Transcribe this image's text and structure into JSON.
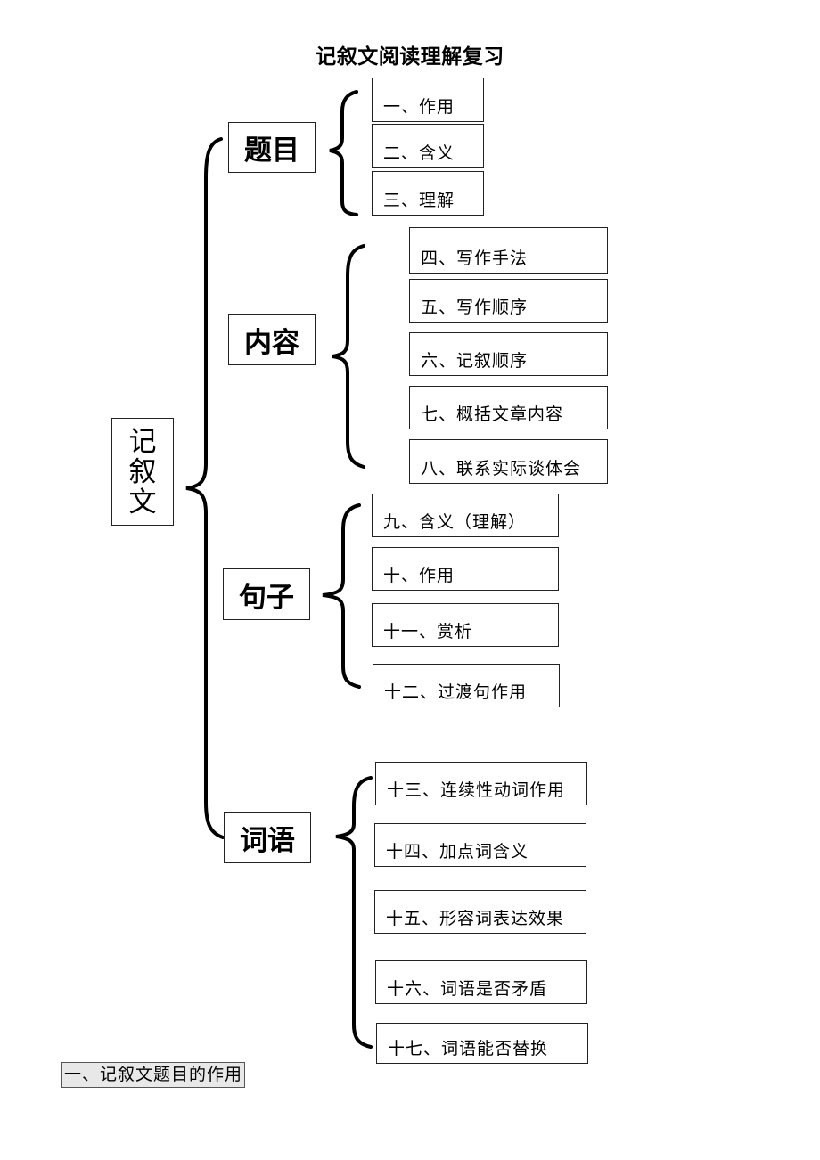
{
  "title": "记叙文阅读理解复习",
  "root": {
    "label": "记叙文",
    "chars": [
      "记",
      "叙",
      "文"
    ]
  },
  "categories": [
    {
      "label": "题目",
      "items": [
        "一、作用",
        "二、含义",
        "三、理解"
      ]
    },
    {
      "label": "内容",
      "items": [
        "四、写作手法",
        "五、写作顺序",
        "六、记叙顺序",
        "七、概括文章内容",
        "八、联系实际谈体会"
      ]
    },
    {
      "label": "句子",
      "items": [
        "九、含义（理解）",
        "十、作用",
        "十一、赏析",
        "十二、过渡句作用"
      ]
    },
    {
      "label": "词语",
      "items": [
        "十三、连续性动词作用",
        "十四、加点词含义",
        "十五、形容词表达效果",
        "十六、词语是否矛盾",
        "十七、词语能否替换"
      ]
    }
  ],
  "section_heading": "一、记叙文题目的作用"
}
